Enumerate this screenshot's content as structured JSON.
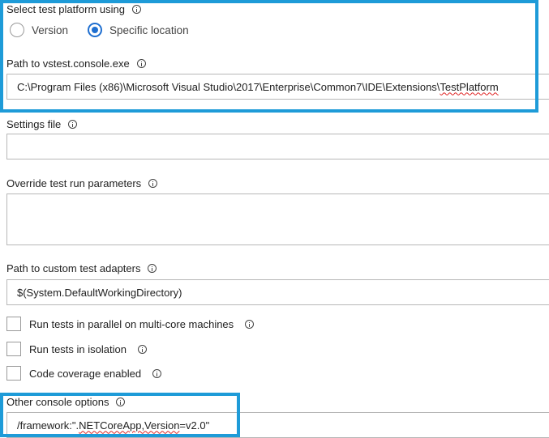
{
  "platform": {
    "label": "Select test platform using",
    "radio_version": "Version",
    "radio_specific": "Specific location",
    "selected": "Specific location"
  },
  "vstest_path": {
    "label": "Path to vstest.console.exe",
    "value_prefix": "C:\\Program Files (x86)\\Microsoft Visual Studio\\2017\\Enterprise\\Common7\\IDE\\Extensions\\",
    "value_tail": "TestPlatform"
  },
  "settings": {
    "label": "Settings file",
    "value": ""
  },
  "override": {
    "label": "Override test run parameters",
    "value": ""
  },
  "adapters": {
    "label": "Path to custom test adapters",
    "value": "$(System.DefaultWorkingDirectory)"
  },
  "checkboxes": [
    {
      "label": "Run tests in parallel on multi-core machines",
      "checked": false
    },
    {
      "label": "Run tests in isolation",
      "checked": false
    },
    {
      "label": "Code coverage enabled",
      "checked": false
    }
  ],
  "console_options": {
    "label": "Other console options",
    "value_prefix": "/framework:\".",
    "value_squiggle": "NETCoreApp,Version",
    "value_suffix": "=v2.0\""
  },
  "icons": {
    "info": "info-icon"
  },
  "colors": {
    "highlight": "#1e9bd8",
    "radio_selected": "#1f6fd0",
    "spellcheck": "#e02424"
  }
}
